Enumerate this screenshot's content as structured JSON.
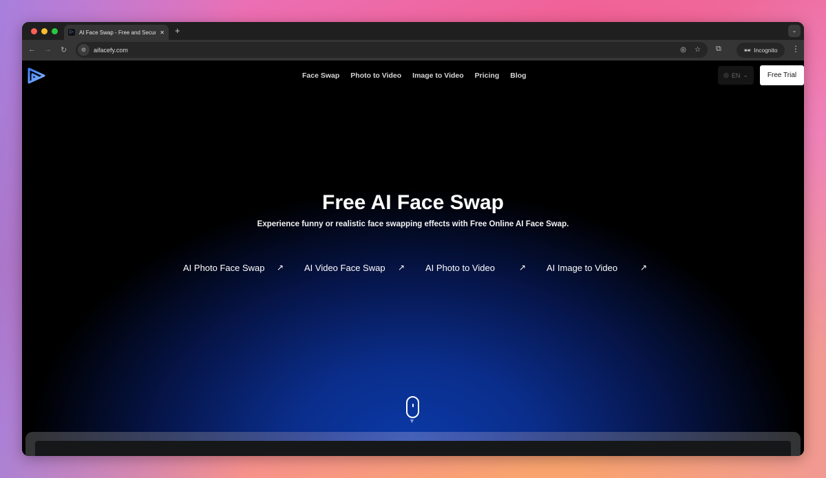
{
  "browser": {
    "tab_title": "AI Face Swap - Free and Secure",
    "url": "aifacefy.com",
    "incognito_label": "Incognito",
    "traffic_colors": [
      "#fe5f57",
      "#febc2e",
      "#28c840"
    ]
  },
  "site": {
    "nav": [
      "Face Swap",
      "Photo to Video",
      "Image to Video",
      "Pricing",
      "Blog"
    ],
    "language": "EN",
    "cta": "Free Trial",
    "accent": "#0a3aa8"
  },
  "hero": {
    "title": "Free AI Face Swap",
    "subtitle": "Experience funny or realistic face swapping effects with Free Online AI Face Swap.",
    "links": [
      {
        "label": "AI Photo Face Swap",
        "icon": "arrow-up-right-icon"
      },
      {
        "label": "AI Video Face Swap",
        "icon": "arrow-up-right-icon"
      },
      {
        "label": "AI Photo to Video",
        "icon": "arrow-up-right-icon"
      },
      {
        "label": "AI Image to Video",
        "icon": "arrow-up-right-icon"
      }
    ]
  }
}
